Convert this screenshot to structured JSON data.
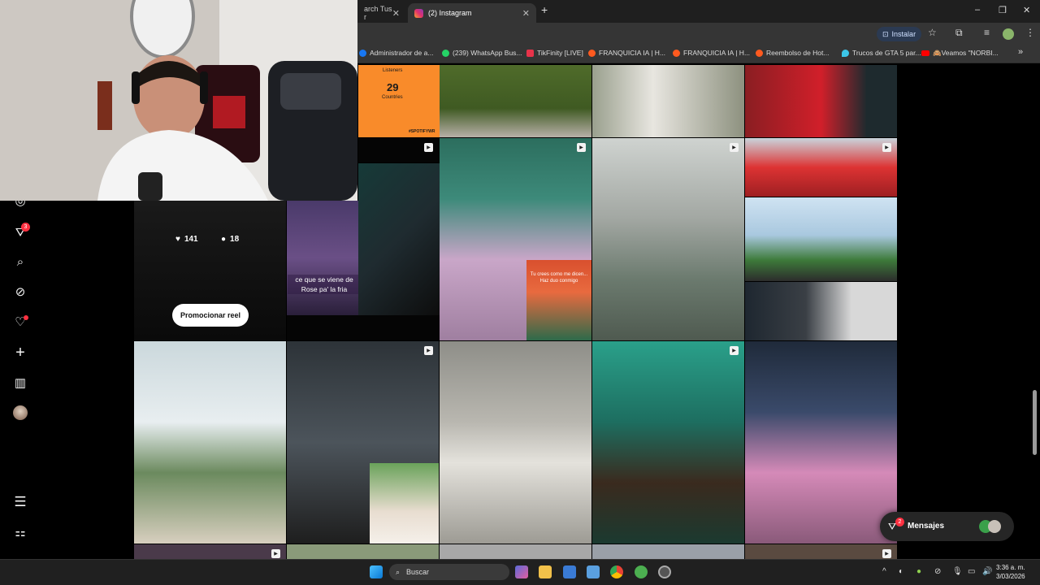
{
  "browser": {
    "tabs": [
      {
        "label": "arch Tus r",
        "close": "✕"
      },
      {
        "label": "(2) Instagram",
        "close": "✕"
      }
    ],
    "new_tab": "+",
    "window_controls": [
      "–",
      "❐",
      "✕"
    ],
    "install_label": "Instalar",
    "bookmarks": [
      "Administrador de a...",
      "(239) WhatsApp Bus...",
      "TikFinity [LIVE]",
      "FRANQUICIA IA | H...",
      "FRANQUICIA IA | H...",
      "Reembolso de Hot...",
      "Trucos de GTA 5 par...",
      "🙈Veamos \"NORBI..."
    ],
    "more_bookmarks": "»"
  },
  "sidebar": {
    "notification_count": "3",
    "items": [
      "messenger",
      "activity",
      "search",
      "explore",
      "notifications",
      "create",
      "dashboard",
      "profile"
    ],
    "bottom": [
      "more",
      "meta-apps"
    ]
  },
  "spotify_card": {
    "label": "Listeners",
    "number": "29",
    "sub": "Countries",
    "tag": "#SPOTIFYWR"
  },
  "reel_overlay": {
    "likes": "141",
    "comments": "18",
    "promote_label": "Promocionar reel"
  },
  "caption_text": "ce que se viene de Rose pa' la fria",
  "sticker_text": "Tu crees como me dicen... Haz duo conmigo",
  "messages": {
    "label": "Mensajes",
    "badge": "2"
  },
  "taskbar": {
    "search_placeholder": "Buscar",
    "time": "3:36 a. m.",
    "date": "3/03/2026"
  },
  "colors": {
    "ig_red": "#ff3040",
    "chrome_dark": "#1f1f1f",
    "chrome_toolbar": "#353535",
    "spotify_orange": "#f98b2a"
  }
}
